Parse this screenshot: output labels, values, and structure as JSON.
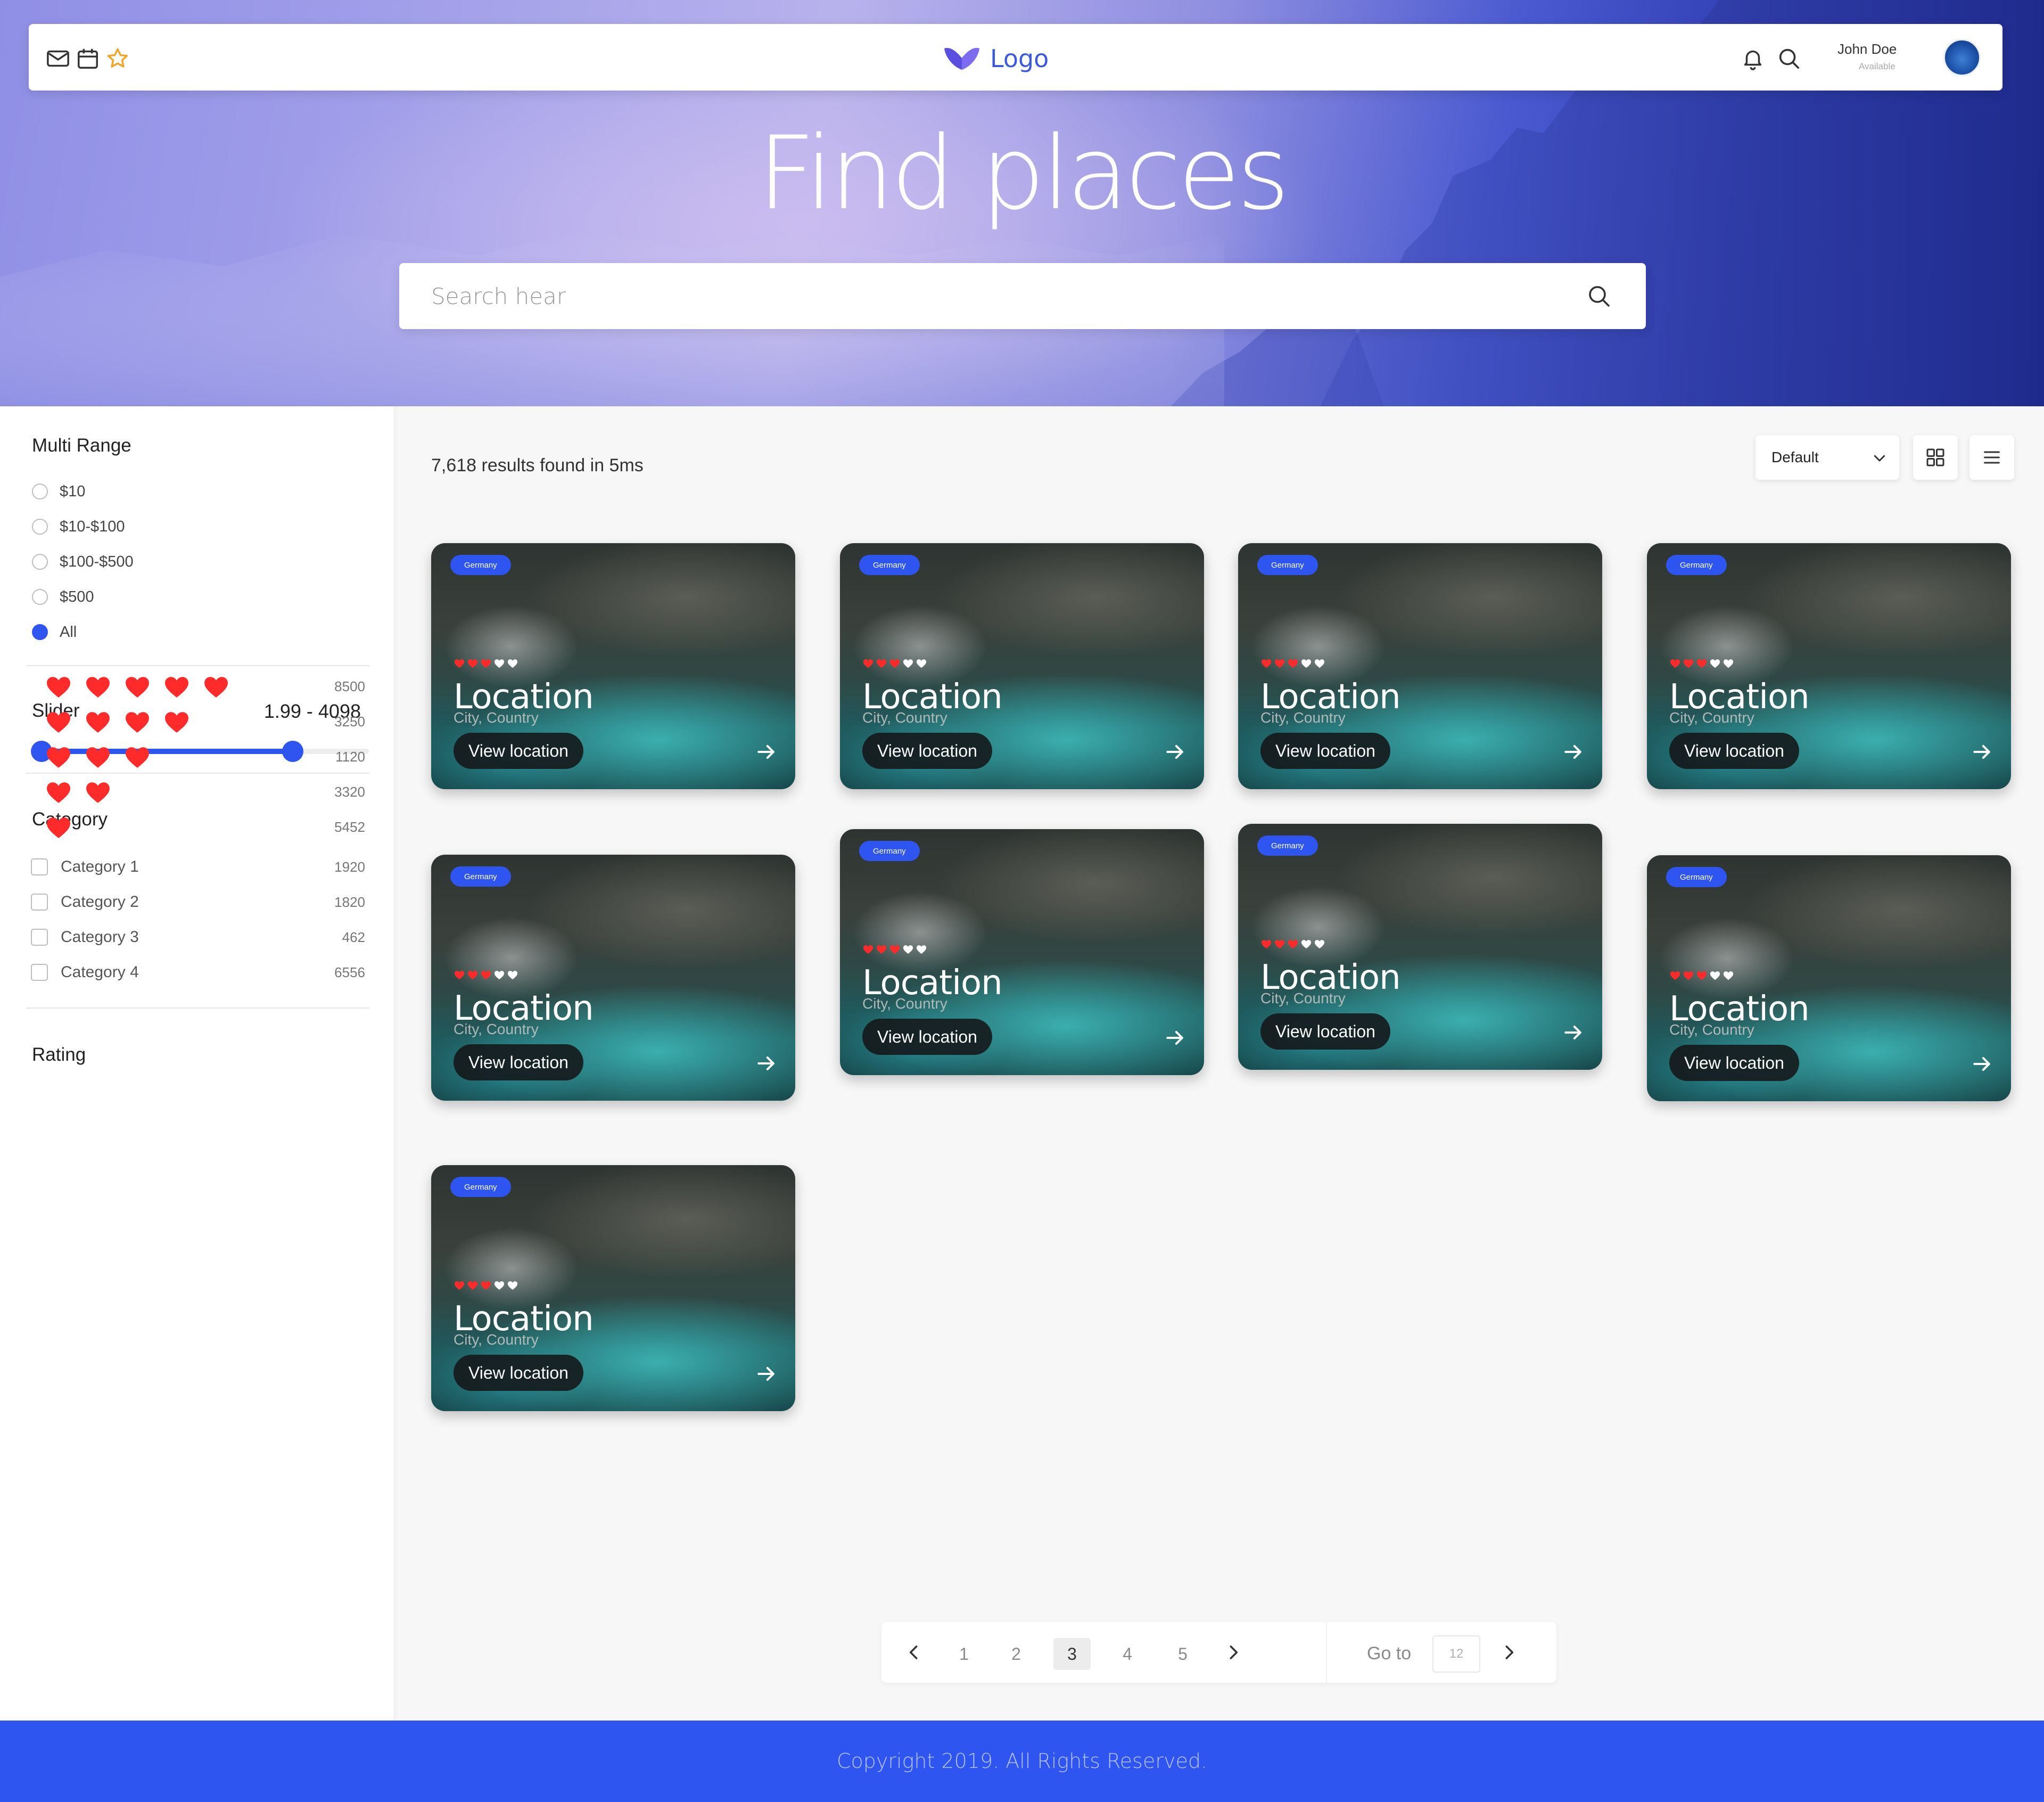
{
  "header": {
    "logo_text": "Logo",
    "user_name": "John Doe",
    "user_status": "Available"
  },
  "hero": {
    "title": "Find places",
    "search_placeholder": "Search hear"
  },
  "filters": {
    "multi_range": {
      "title": "Multi Range",
      "options": [
        "$10",
        "$10-$100",
        "$100-$500",
        "$500",
        "All"
      ],
      "selected": "All"
    },
    "slider": {
      "title": "Slider",
      "range_text": "1.99 - 4098",
      "min": 1.99,
      "max": 4098
    },
    "category": {
      "title": "Category",
      "items": [
        {
          "label": "Category 1",
          "count": "1920"
        },
        {
          "label": "Category 2",
          "count": "1820"
        },
        {
          "label": "Category 3",
          "count": "462"
        },
        {
          "label": "Category 4",
          "count": "6556"
        }
      ]
    },
    "rating": {
      "title": "Rating",
      "rows": [
        {
          "hearts": 5,
          "count": "8500"
        },
        {
          "hearts": 4,
          "count": "3250"
        },
        {
          "hearts": 3,
          "count": "1120"
        },
        {
          "hearts": 2,
          "count": "3320"
        },
        {
          "hearts": 1,
          "count": "5452"
        }
      ]
    }
  },
  "results": {
    "summary": "7,618 results found in 5ms",
    "sort_value": "Default"
  },
  "cards": [
    {
      "tag": "Germany",
      "title": "Location",
      "subtitle": "City, Country",
      "button": "View location",
      "rating": 3
    },
    {
      "tag": "Germany",
      "title": "Location",
      "subtitle": "City, Country",
      "button": "View location",
      "rating": 3
    },
    {
      "tag": "Germany",
      "title": "Location",
      "subtitle": "City, Country",
      "button": "View location",
      "rating": 3
    },
    {
      "tag": "Germany",
      "title": "Location",
      "subtitle": "City, Country",
      "button": "View location",
      "rating": 3
    },
    {
      "tag": "Germany",
      "title": "Location",
      "subtitle": "City, Country",
      "button": "View location",
      "rating": 3
    },
    {
      "tag": "Germany",
      "title": "Location",
      "subtitle": "City, Country",
      "button": "View location",
      "rating": 3
    },
    {
      "tag": "Germany",
      "title": "Location",
      "subtitle": "City, Country",
      "button": "View location",
      "rating": 3
    },
    {
      "tag": "Germany",
      "title": "Location",
      "subtitle": "City, Country",
      "button": "View location",
      "rating": 3
    },
    {
      "tag": "Germany",
      "title": "Location",
      "subtitle": "City, Country",
      "button": "View location",
      "rating": 3
    }
  ],
  "pagination": {
    "pages": [
      "1",
      "2",
      "3",
      "4",
      "5"
    ],
    "current": "3",
    "goto_label": "Go to",
    "goto_value": "12"
  },
  "footer": {
    "copyright": "Copyright 2019. All Rights Reserved."
  },
  "colors": {
    "accent": "#2f55f1",
    "heart": "#ff2b2b"
  },
  "icons": [
    "mail-icon",
    "calendar-icon",
    "star-icon",
    "bell-icon",
    "search-icon",
    "grid-view-icon",
    "list-view-icon",
    "arrow-right-icon",
    "chevron-left-icon",
    "chevron-right-icon",
    "chevron-down-icon",
    "heart-icon"
  ]
}
